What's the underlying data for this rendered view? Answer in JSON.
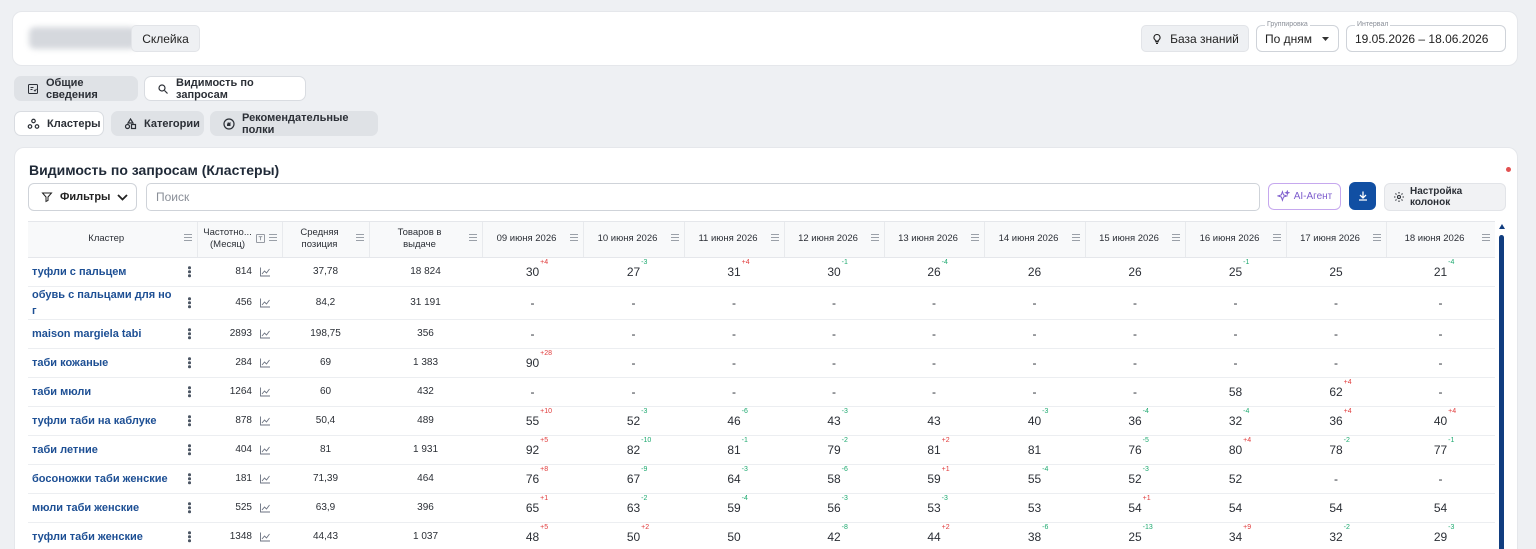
{
  "header": {
    "glue_label": "Склейка",
    "knowledge_label": "База знаний",
    "grouping_label": "Группировка",
    "grouping_value": "По дням",
    "interval_label": "Интервал",
    "interval_value": "19.05.2026 – 18.06.2026"
  },
  "nav_tabs": [
    {
      "label": "Общие сведения",
      "active": true
    },
    {
      "label": "Видимость по запросам",
      "active": false
    }
  ],
  "sub_tabs": [
    {
      "label": "Кластеры",
      "active": false
    },
    {
      "label": "Категории",
      "active": true
    },
    {
      "label": "Рекомендательные полки",
      "active": true
    }
  ],
  "card": {
    "title": "Видимость по запросам (Кластеры)",
    "filters_label": "Фильтры",
    "search_placeholder": "Поиск",
    "ai_label": "AI-Агент",
    "columns_label": "Настройка колонок"
  },
  "table": {
    "headers": {
      "cluster": "Кластер",
      "freq_1": "Частотно...",
      "freq_2": "(Месяц)",
      "avg_1": "Средняя",
      "avg_2": "позиция",
      "goods_1": "Товаров в",
      "goods_2": "выдаче"
    },
    "dates": [
      "09 июня 2026",
      "10 июня 2026",
      "11 июня 2026",
      "12 июня 2026",
      "13 июня 2026",
      "14 июня 2026",
      "15 июня 2026",
      "16 июня 2026",
      "17 июня 2026",
      "18 июня 2026"
    ],
    "rows": [
      {
        "name": "туфли с пальцем",
        "freq": "814",
        "avg": "37,78",
        "goods": "18 824",
        "days": [
          {
            "v": "30",
            "d": "+4"
          },
          {
            "v": "27",
            "d": "-3"
          },
          {
            "v": "31",
            "d": "+4"
          },
          {
            "v": "30",
            "d": "-1"
          },
          {
            "v": "26",
            "d": "-4"
          },
          {
            "v": "26",
            "d": ""
          },
          {
            "v": "26",
            "d": ""
          },
          {
            "v": "25",
            "d": "-1"
          },
          {
            "v": "25",
            "d": ""
          },
          {
            "v": "21",
            "d": "-4"
          }
        ]
      },
      {
        "name": "обувь с пальцами для но г",
        "freq": "456",
        "avg": "84,2",
        "goods": "31 191",
        "days": [
          {
            "v": "-",
            "d": ""
          },
          {
            "v": "-",
            "d": ""
          },
          {
            "v": "-",
            "d": ""
          },
          {
            "v": "-",
            "d": ""
          },
          {
            "v": "-",
            "d": ""
          },
          {
            "v": "-",
            "d": ""
          },
          {
            "v": "-",
            "d": ""
          },
          {
            "v": "-",
            "d": ""
          },
          {
            "v": "-",
            "d": ""
          },
          {
            "v": "-",
            "d": ""
          }
        ]
      },
      {
        "name": "maison margiela tabi",
        "freq": "2893",
        "avg": "198,75",
        "goods": "356",
        "days": [
          {
            "v": "-",
            "d": ""
          },
          {
            "v": "-",
            "d": ""
          },
          {
            "v": "-",
            "d": ""
          },
          {
            "v": "-",
            "d": ""
          },
          {
            "v": "-",
            "d": ""
          },
          {
            "v": "-",
            "d": ""
          },
          {
            "v": "-",
            "d": ""
          },
          {
            "v": "-",
            "d": ""
          },
          {
            "v": "-",
            "d": ""
          },
          {
            "v": "-",
            "d": ""
          }
        ]
      },
      {
        "name": "таби кожаные",
        "freq": "284",
        "avg": "69",
        "goods": "1 383",
        "days": [
          {
            "v": "90",
            "d": "+28"
          },
          {
            "v": "-",
            "d": ""
          },
          {
            "v": "-",
            "d": ""
          },
          {
            "v": "-",
            "d": ""
          },
          {
            "v": "-",
            "d": ""
          },
          {
            "v": "-",
            "d": ""
          },
          {
            "v": "-",
            "d": ""
          },
          {
            "v": "-",
            "d": ""
          },
          {
            "v": "-",
            "d": ""
          },
          {
            "v": "-",
            "d": ""
          }
        ]
      },
      {
        "name": "таби мюли",
        "freq": "1264",
        "avg": "60",
        "goods": "432",
        "days": [
          {
            "v": "-",
            "d": ""
          },
          {
            "v": "-",
            "d": ""
          },
          {
            "v": "-",
            "d": ""
          },
          {
            "v": "-",
            "d": ""
          },
          {
            "v": "-",
            "d": ""
          },
          {
            "v": "-",
            "d": ""
          },
          {
            "v": "-",
            "d": ""
          },
          {
            "v": "58",
            "d": ""
          },
          {
            "v": "62",
            "d": "+4"
          },
          {
            "v": "-",
            "d": ""
          }
        ]
      },
      {
        "name": "туфли таби на каблуке",
        "freq": "878",
        "avg": "50,4",
        "goods": "489",
        "days": [
          {
            "v": "55",
            "d": "+10"
          },
          {
            "v": "52",
            "d": "-3"
          },
          {
            "v": "46",
            "d": "-6"
          },
          {
            "v": "43",
            "d": "-3"
          },
          {
            "v": "43",
            "d": ""
          },
          {
            "v": "40",
            "d": "-3"
          },
          {
            "v": "36",
            "d": "-4"
          },
          {
            "v": "32",
            "d": "-4"
          },
          {
            "v": "36",
            "d": "+4"
          },
          {
            "v": "40",
            "d": "+4"
          }
        ]
      },
      {
        "name": "таби летние",
        "freq": "404",
        "avg": "81",
        "goods": "1 931",
        "days": [
          {
            "v": "92",
            "d": "+5"
          },
          {
            "v": "82",
            "d": "-10"
          },
          {
            "v": "81",
            "d": "-1"
          },
          {
            "v": "79",
            "d": "-2"
          },
          {
            "v": "81",
            "d": "+2"
          },
          {
            "v": "81",
            "d": ""
          },
          {
            "v": "76",
            "d": "-5"
          },
          {
            "v": "80",
            "d": "+4"
          },
          {
            "v": "78",
            "d": "-2"
          },
          {
            "v": "77",
            "d": "-1"
          }
        ]
      },
      {
        "name": "босоножки таби женские",
        "freq": "181",
        "avg": "71,39",
        "goods": "464",
        "days": [
          {
            "v": "76",
            "d": "+8"
          },
          {
            "v": "67",
            "d": "-9"
          },
          {
            "v": "64",
            "d": "-3"
          },
          {
            "v": "58",
            "d": "-6"
          },
          {
            "v": "59",
            "d": "+1"
          },
          {
            "v": "55",
            "d": "-4"
          },
          {
            "v": "52",
            "d": "-3"
          },
          {
            "v": "52",
            "d": ""
          },
          {
            "v": "-",
            "d": ""
          },
          {
            "v": "-",
            "d": ""
          }
        ]
      },
      {
        "name": "мюли таби женские",
        "freq": "525",
        "avg": "63,9",
        "goods": "396",
        "days": [
          {
            "v": "65",
            "d": "+1"
          },
          {
            "v": "63",
            "d": "-2"
          },
          {
            "v": "59",
            "d": "-4"
          },
          {
            "v": "56",
            "d": "-3"
          },
          {
            "v": "53",
            "d": "-3"
          },
          {
            "v": "53",
            "d": ""
          },
          {
            "v": "54",
            "d": "+1"
          },
          {
            "v": "54",
            "d": ""
          },
          {
            "v": "54",
            "d": ""
          },
          {
            "v": "54",
            "d": ""
          }
        ]
      },
      {
        "name": "туфли таби женские",
        "freq": "1348",
        "avg": "44,43",
        "goods": "1 037",
        "days": [
          {
            "v": "48",
            "d": "+5"
          },
          {
            "v": "50",
            "d": "+2"
          },
          {
            "v": "50",
            "d": ""
          },
          {
            "v": "42",
            "d": "-8"
          },
          {
            "v": "44",
            "d": "+2"
          },
          {
            "v": "38",
            "d": "-6"
          },
          {
            "v": "25",
            "d": "-13"
          },
          {
            "v": "34",
            "d": "+9"
          },
          {
            "v": "32",
            "d": "-2"
          },
          {
            "v": "29",
            "d": "-3"
          }
        ]
      }
    ]
  }
}
